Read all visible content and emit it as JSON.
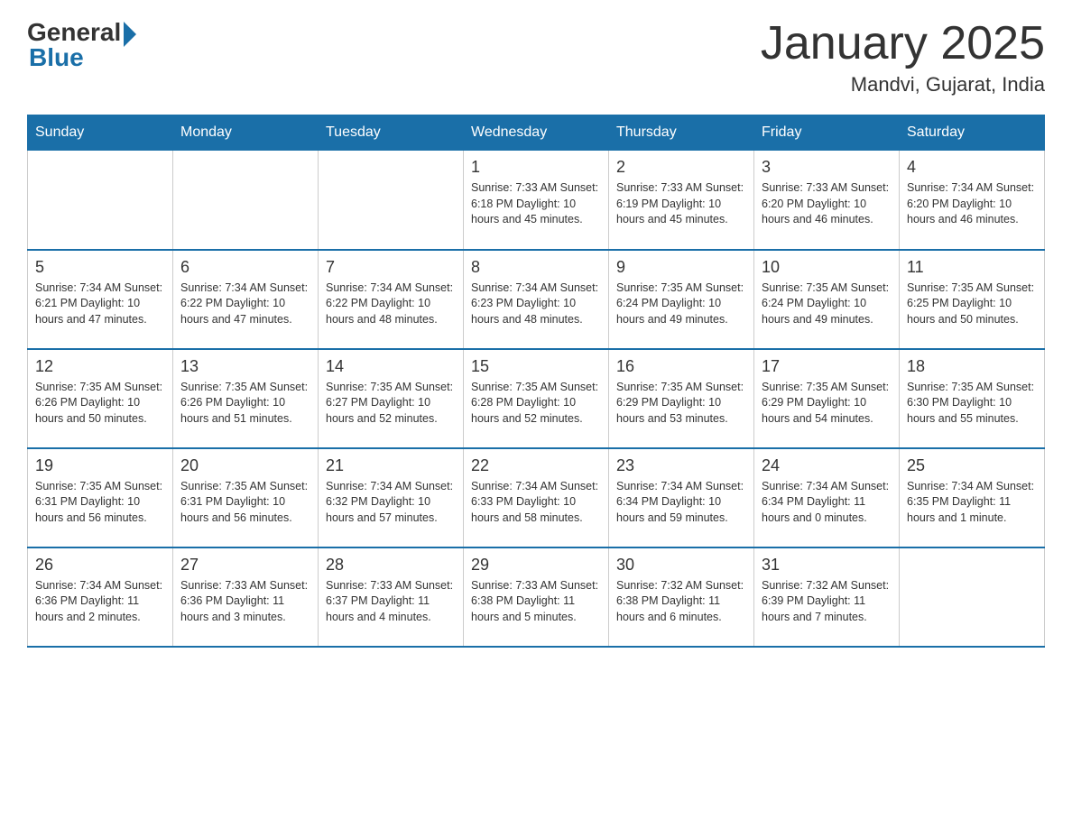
{
  "header": {
    "logo_general": "General",
    "logo_blue": "Blue",
    "month_title": "January 2025",
    "location": "Mandvi, Gujarat, India"
  },
  "days_of_week": [
    "Sunday",
    "Monday",
    "Tuesday",
    "Wednesday",
    "Thursday",
    "Friday",
    "Saturday"
  ],
  "weeks": [
    [
      {
        "day": "",
        "info": ""
      },
      {
        "day": "",
        "info": ""
      },
      {
        "day": "",
        "info": ""
      },
      {
        "day": "1",
        "info": "Sunrise: 7:33 AM\nSunset: 6:18 PM\nDaylight: 10 hours\nand 45 minutes."
      },
      {
        "day": "2",
        "info": "Sunrise: 7:33 AM\nSunset: 6:19 PM\nDaylight: 10 hours\nand 45 minutes."
      },
      {
        "day": "3",
        "info": "Sunrise: 7:33 AM\nSunset: 6:20 PM\nDaylight: 10 hours\nand 46 minutes."
      },
      {
        "day": "4",
        "info": "Sunrise: 7:34 AM\nSunset: 6:20 PM\nDaylight: 10 hours\nand 46 minutes."
      }
    ],
    [
      {
        "day": "5",
        "info": "Sunrise: 7:34 AM\nSunset: 6:21 PM\nDaylight: 10 hours\nand 47 minutes."
      },
      {
        "day": "6",
        "info": "Sunrise: 7:34 AM\nSunset: 6:22 PM\nDaylight: 10 hours\nand 47 minutes."
      },
      {
        "day": "7",
        "info": "Sunrise: 7:34 AM\nSunset: 6:22 PM\nDaylight: 10 hours\nand 48 minutes."
      },
      {
        "day": "8",
        "info": "Sunrise: 7:34 AM\nSunset: 6:23 PM\nDaylight: 10 hours\nand 48 minutes."
      },
      {
        "day": "9",
        "info": "Sunrise: 7:35 AM\nSunset: 6:24 PM\nDaylight: 10 hours\nand 49 minutes."
      },
      {
        "day": "10",
        "info": "Sunrise: 7:35 AM\nSunset: 6:24 PM\nDaylight: 10 hours\nand 49 minutes."
      },
      {
        "day": "11",
        "info": "Sunrise: 7:35 AM\nSunset: 6:25 PM\nDaylight: 10 hours\nand 50 minutes."
      }
    ],
    [
      {
        "day": "12",
        "info": "Sunrise: 7:35 AM\nSunset: 6:26 PM\nDaylight: 10 hours\nand 50 minutes."
      },
      {
        "day": "13",
        "info": "Sunrise: 7:35 AM\nSunset: 6:26 PM\nDaylight: 10 hours\nand 51 minutes."
      },
      {
        "day": "14",
        "info": "Sunrise: 7:35 AM\nSunset: 6:27 PM\nDaylight: 10 hours\nand 52 minutes."
      },
      {
        "day": "15",
        "info": "Sunrise: 7:35 AM\nSunset: 6:28 PM\nDaylight: 10 hours\nand 52 minutes."
      },
      {
        "day": "16",
        "info": "Sunrise: 7:35 AM\nSunset: 6:29 PM\nDaylight: 10 hours\nand 53 minutes."
      },
      {
        "day": "17",
        "info": "Sunrise: 7:35 AM\nSunset: 6:29 PM\nDaylight: 10 hours\nand 54 minutes."
      },
      {
        "day": "18",
        "info": "Sunrise: 7:35 AM\nSunset: 6:30 PM\nDaylight: 10 hours\nand 55 minutes."
      }
    ],
    [
      {
        "day": "19",
        "info": "Sunrise: 7:35 AM\nSunset: 6:31 PM\nDaylight: 10 hours\nand 56 minutes."
      },
      {
        "day": "20",
        "info": "Sunrise: 7:35 AM\nSunset: 6:31 PM\nDaylight: 10 hours\nand 56 minutes."
      },
      {
        "day": "21",
        "info": "Sunrise: 7:34 AM\nSunset: 6:32 PM\nDaylight: 10 hours\nand 57 minutes."
      },
      {
        "day": "22",
        "info": "Sunrise: 7:34 AM\nSunset: 6:33 PM\nDaylight: 10 hours\nand 58 minutes."
      },
      {
        "day": "23",
        "info": "Sunrise: 7:34 AM\nSunset: 6:34 PM\nDaylight: 10 hours\nand 59 minutes."
      },
      {
        "day": "24",
        "info": "Sunrise: 7:34 AM\nSunset: 6:34 PM\nDaylight: 11 hours\nand 0 minutes."
      },
      {
        "day": "25",
        "info": "Sunrise: 7:34 AM\nSunset: 6:35 PM\nDaylight: 11 hours\nand 1 minute."
      }
    ],
    [
      {
        "day": "26",
        "info": "Sunrise: 7:34 AM\nSunset: 6:36 PM\nDaylight: 11 hours\nand 2 minutes."
      },
      {
        "day": "27",
        "info": "Sunrise: 7:33 AM\nSunset: 6:36 PM\nDaylight: 11 hours\nand 3 minutes."
      },
      {
        "day": "28",
        "info": "Sunrise: 7:33 AM\nSunset: 6:37 PM\nDaylight: 11 hours\nand 4 minutes."
      },
      {
        "day": "29",
        "info": "Sunrise: 7:33 AM\nSunset: 6:38 PM\nDaylight: 11 hours\nand 5 minutes."
      },
      {
        "day": "30",
        "info": "Sunrise: 7:32 AM\nSunset: 6:38 PM\nDaylight: 11 hours\nand 6 minutes."
      },
      {
        "day": "31",
        "info": "Sunrise: 7:32 AM\nSunset: 6:39 PM\nDaylight: 11 hours\nand 7 minutes."
      },
      {
        "day": "",
        "info": ""
      }
    ]
  ]
}
